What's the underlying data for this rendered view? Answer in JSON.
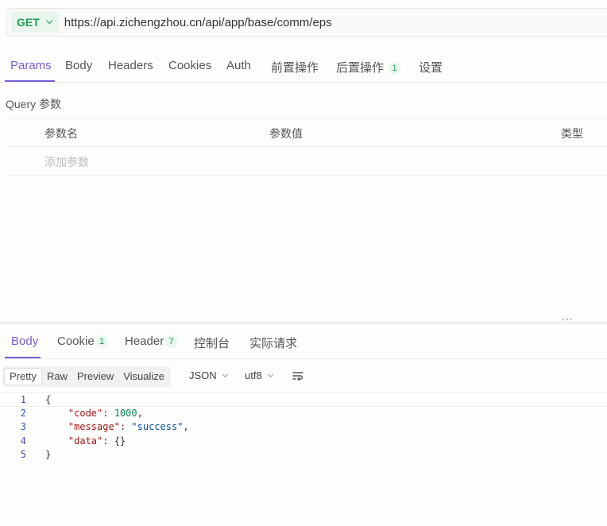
{
  "request": {
    "method": "GET",
    "url": "https://api.zichengzhou.cn/api/app/base/comm/eps"
  },
  "request_tabs": [
    {
      "label": "Params",
      "active": true
    },
    {
      "label": "Body"
    },
    {
      "label": "Headers"
    },
    {
      "label": "Cookies"
    },
    {
      "label": "Auth"
    },
    {
      "label": "前置操作"
    },
    {
      "label": "后置操作",
      "badge": "1"
    },
    {
      "label": "设置"
    }
  ],
  "params": {
    "section_label": "Query 参数",
    "col_name": "参数名",
    "col_value": "参数值",
    "col_type": "类型",
    "add_placeholder": "添加参数"
  },
  "response_tabs": [
    {
      "label": "Body",
      "active": true
    },
    {
      "label": "Cookie",
      "badge": "1"
    },
    {
      "label": "Header",
      "badge": "7"
    },
    {
      "label": "控制台"
    },
    {
      "label": "实际请求"
    }
  ],
  "viewer": {
    "modes": [
      "Pretty",
      "Raw",
      "Preview",
      "Visualize"
    ],
    "active_mode": "Pretty",
    "format": "JSON",
    "encoding": "utf8"
  },
  "code": {
    "line_numbers": [
      "1",
      "2",
      "3",
      "4",
      "5"
    ],
    "open_brace": "{",
    "close_brace": "}",
    "k_code": "\"code\"",
    "v_code": "1000",
    "k_message": "\"message\"",
    "v_message": "\"success\"",
    "k_data": "\"data\"",
    "v_data": "{}"
  },
  "colors": {
    "accent": "#7b5cd6",
    "method_green": "#1f9d55"
  }
}
